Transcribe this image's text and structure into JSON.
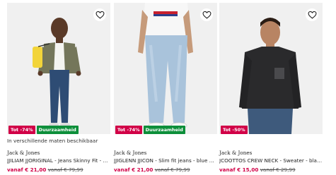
{
  "products": [
    {
      "badges": [
        "Tot -74%",
        "Duurzaamheid"
      ],
      "availability": "In verschillende maten beschikbaar",
      "brand": "Jack & Jones",
      "title": "JJILIAM JJORIGINAL - Jeans Skinny Fit - ...",
      "price_from": "vanaf € 21,00",
      "price_old": "vanaf € 79,99"
    },
    {
      "badges": [
        "Tot -74%",
        "Duurzaamheid"
      ],
      "availability": "",
      "brand": "Jack & Jones",
      "title": "JJIGLENN JJICON - Slim fit jeans - blue d...",
      "price_from": "vanaf € 21,00",
      "price_old": "vanaf € 79,99"
    },
    {
      "badges": [
        "Tot -50%"
      ],
      "availability": "",
      "brand": "Jack & Jones",
      "title": "JCOOTTOS CREW NECK - Sweater - black",
      "price_from": "vanaf € 15,00",
      "price_old": "vanaf € 29,99"
    }
  ],
  "icons": {
    "wishlist": "heart-outline-icon"
  },
  "colors": {
    "sale": "#d10047",
    "eco": "#0d8f3a",
    "text": "#1f1f1f",
    "image_bg": "#f0f0f0"
  }
}
